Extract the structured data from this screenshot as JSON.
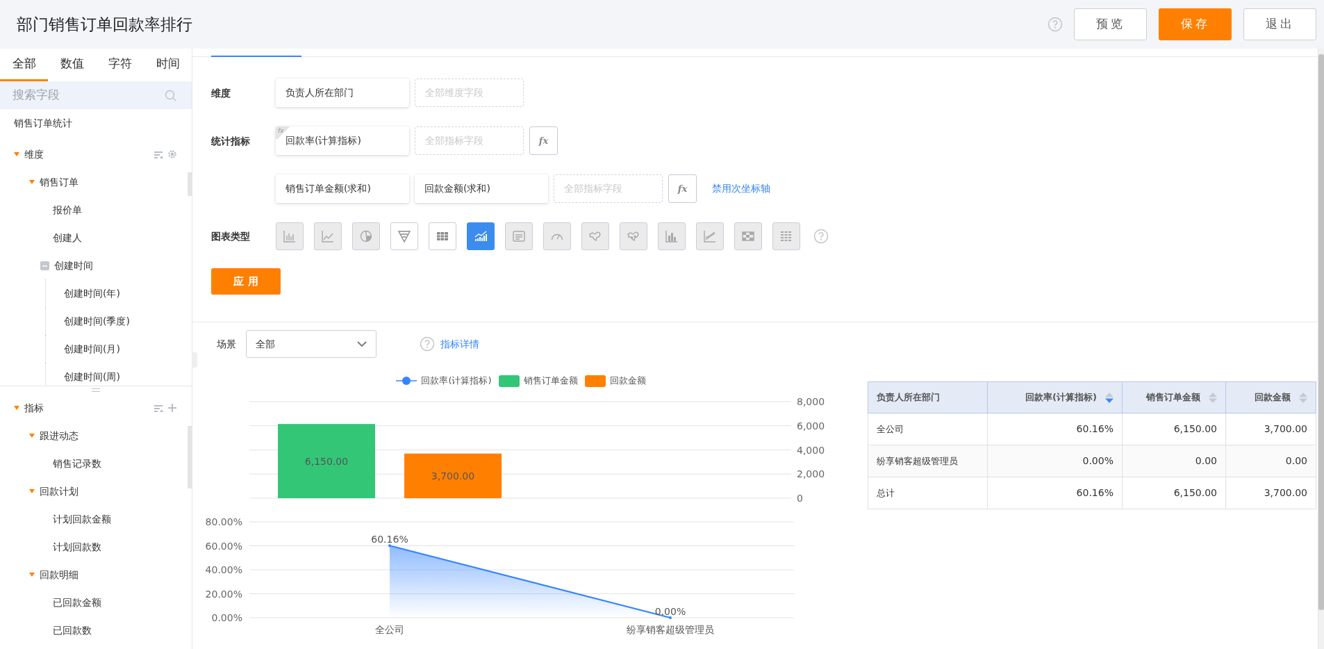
{
  "header": {
    "title": "部门销售订单回款率排行",
    "buttons": [
      {
        "label": "预览",
        "kind": "default"
      },
      {
        "label": "保存",
        "kind": "primary"
      },
      {
        "label": "退出",
        "kind": "default"
      }
    ]
  },
  "sidebar": {
    "tabs": [
      {
        "label": "全部",
        "selected": true
      },
      {
        "label": "数值",
        "selected": false
      },
      {
        "label": "字符",
        "selected": false
      },
      {
        "label": "时间",
        "selected": false
      }
    ],
    "search": {
      "placeholder": "搜索字段"
    },
    "source": "销售订单统计",
    "dimensions": {
      "label": "维度",
      "expanded": true,
      "children": [
        {
          "label": "销售订单",
          "kind": "group",
          "expanded": true,
          "children": [
            {
              "label": "报价单"
            },
            {
              "label": "创建人"
            },
            {
              "label": "创建时间",
              "kind": "box",
              "expanded": true,
              "children": [
                {
                  "label": "创建时间(年)"
                },
                {
                  "label": "创建时间(季度)"
                },
                {
                  "label": "创建时间(月)"
                },
                {
                  "label": "创建时间(周)"
                }
              ]
            }
          ]
        }
      ]
    },
    "metrics": {
      "label": "指标",
      "expanded": true,
      "children": [
        {
          "label": "跟进动态",
          "kind": "group",
          "expanded": true,
          "children": [
            {
              "label": "销售记录数"
            }
          ]
        },
        {
          "label": "回款计划",
          "kind": "group",
          "expanded": true,
          "children": [
            {
              "label": "计划回款金额"
            },
            {
              "label": "计划回款数"
            }
          ]
        },
        {
          "label": "回款明细",
          "kind": "group",
          "expanded": true,
          "children": [
            {
              "label": "已回款金额"
            },
            {
              "label": "已回款数"
            }
          ]
        }
      ]
    }
  },
  "config": {
    "rows": [
      {
        "label": "维度",
        "fields": [
          {
            "label": "负责人所在部门",
            "kind": "field"
          },
          {
            "placeholder": "全部维度字段",
            "kind": "slot"
          }
        ]
      },
      {
        "label": "统计指标",
        "fields": [
          {
            "label": "回款率(计算指标)",
            "kind": "calculated",
            "badge": "fx"
          },
          {
            "placeholder": "全部指标字段",
            "kind": "slot"
          },
          {
            "label": "fx",
            "kind": "formula"
          }
        ]
      },
      {
        "fields": [
          {
            "label": "销售订单金额(求和)",
            "kind": "field"
          },
          {
            "label": "回款金额(求和)",
            "kind": "field"
          },
          {
            "placeholder": "全部指标字段",
            "kind": "slot"
          },
          {
            "label": "fx",
            "kind": "formula"
          },
          {
            "label": "禁用次坐标轴",
            "kind": "link"
          }
        ]
      }
    ],
    "chart_types_label": "图表类型",
    "chart_types": [
      {
        "kind": "bar",
        "selected": false,
        "disabled": true
      },
      {
        "kind": "line",
        "selected": false,
        "disabled": true
      },
      {
        "kind": "pie",
        "selected": false,
        "disabled": true
      },
      {
        "kind": "funnel",
        "selected": false,
        "disabled": false
      },
      {
        "kind": "table",
        "selected": false,
        "disabled": false
      },
      {
        "kind": "combo",
        "selected": true,
        "disabled": false
      },
      {
        "kind": "card",
        "selected": false,
        "disabled": true
      },
      {
        "kind": "gauge",
        "selected": false,
        "disabled": true
      },
      {
        "kind": "map",
        "selected": false,
        "disabled": true
      },
      {
        "kind": "dotmap",
        "selected": false,
        "disabled": true
      },
      {
        "kind": "column",
        "selected": false,
        "disabled": true
      },
      {
        "kind": "area",
        "selected": false,
        "disabled": true
      },
      {
        "kind": "heatmap",
        "selected": false,
        "disabled": true
      },
      {
        "kind": "pivot",
        "selected": false,
        "disabled": true
      }
    ],
    "apply_button": "应 用"
  },
  "scene": {
    "label": "场景",
    "value": "全部",
    "link": "指标详情"
  },
  "bar_panel": {
    "chart_data": {
      "type": "bar",
      "stacked": false,
      "grid": true,
      "ylim": [
        0,
        8000
      ],
      "yticks": [
        {
          "value": 0,
          "label": "0"
        },
        {
          "value": 2000,
          "label": "2,000"
        },
        {
          "value": 4000,
          "label": "4,000"
        },
        {
          "value": 6000,
          "label": "6,000"
        },
        {
          "value": 8000,
          "label": "8,000"
        }
      ],
      "series": [
        {
          "name": "销售订单金额",
          "color": "#33c677",
          "values": [
            6150,
            0
          ],
          "value_labels": [
            "6,150.00",
            null
          ]
        },
        {
          "name": "回款金额",
          "color": "#ff8000",
          "values": [
            3700,
            0
          ],
          "value_labels": [
            "3,700.00",
            null
          ]
        }
      ]
    }
  },
  "line_panel": {
    "chart_data": {
      "type": "area",
      "grid": true,
      "categories": [
        "全公司",
        "纷享销客超级管理员"
      ],
      "ylim": [
        0,
        80
      ],
      "yticks": [
        {
          "value": 0,
          "label": "0.00%"
        },
        {
          "value": 20,
          "label": "20.00%"
        },
        {
          "value": 40,
          "label": "40.00%"
        },
        {
          "value": 60,
          "label": "60.00%"
        },
        {
          "value": 80,
          "label": "80.00%"
        }
      ],
      "series": [
        {
          "name": "回款率(计算指标)",
          "color": "#3384ff",
          "values": [
            60.16,
            0
          ],
          "value_labels": [
            "60.16%",
            "0.00%"
          ]
        }
      ]
    }
  },
  "table": {
    "columns": [
      {
        "label": "负责人所在部门",
        "sortable": false
      },
      {
        "label": "回款率(计算指标)",
        "sortable": true,
        "sort_active": true
      },
      {
        "label": "销售订单金额",
        "sortable": true,
        "sort_active": false
      },
      {
        "label": "回款金额",
        "sortable": true,
        "sort_active": false
      }
    ],
    "rows": [
      [
        "全公司",
        "60.16%",
        "6,150.00",
        "3,700.00"
      ],
      [
        "纷享销客超级管理员",
        "0.00%",
        "0.00",
        "0.00"
      ],
      [
        "总计",
        "60.16%",
        "6,150.00",
        "3,700.00"
      ]
    ]
  }
}
